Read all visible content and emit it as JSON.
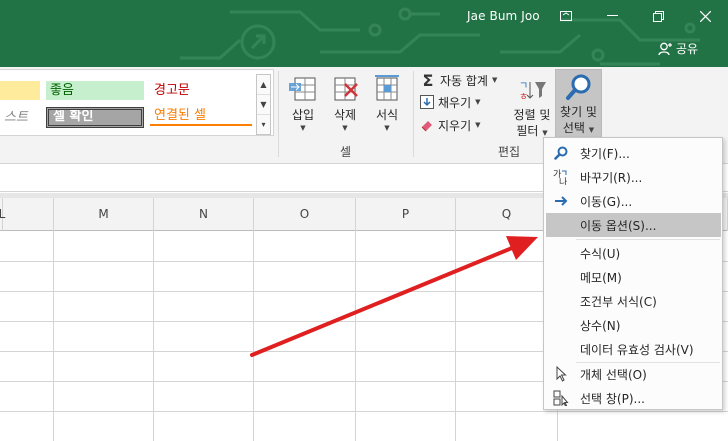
{
  "titlebar": {
    "user_name": "Jae Bum Joo",
    "share_label": "공유",
    "bg_color": "#217346"
  },
  "ribbon": {
    "styles": {
      "neutral": "",
      "good": "좋음",
      "bad": "경고문",
      "explanatory": "스트",
      "check_cell": "셀 확인",
      "linked_cell": "연결된 셀"
    },
    "cells_group": {
      "insert": "삽입",
      "delete": "삭제",
      "format": "서식",
      "label": "셀"
    },
    "editing_group": {
      "autosum": "자동 합계",
      "fill": "채우기",
      "clear": "지우기",
      "sort_filter_1": "정렬 및",
      "sort_filter_2": "필터",
      "find_select_1": "찾기 및",
      "find_select_2": "선택",
      "label": "편집"
    }
  },
  "columns": [
    "L",
    "M",
    "N",
    "O",
    "P",
    "Q"
  ],
  "find_menu": {
    "items": [
      {
        "label": "찾기(F)...",
        "icon": "search-icon"
      },
      {
        "label": "바꾸기(R)...",
        "icon": "replace-icon"
      },
      {
        "label": "이동(G)...",
        "icon": "arrow-right-icon"
      },
      {
        "label": "이동 옵션(S)...",
        "icon": "",
        "highlighted": true
      },
      {
        "label": "수식(U)"
      },
      {
        "label": "메모(M)"
      },
      {
        "label": "조건부 서식(C)"
      },
      {
        "label": "상수(N)"
      },
      {
        "label": "데이터 유효성 검사(V)"
      },
      {
        "label": "개체 선택(O)",
        "icon": "pointer-icon"
      },
      {
        "label": "선택 창(P)...",
        "icon": "selection-pane-icon"
      }
    ]
  },
  "annotation_color": "#e02020"
}
